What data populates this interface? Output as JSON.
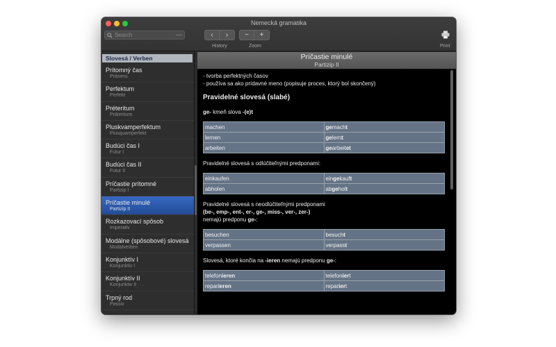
{
  "window": {
    "title": "Nemecká gramatika"
  },
  "toolbar": {
    "search_placeholder": "Search",
    "back_glyph": "‹",
    "forward_glyph": "›",
    "zoom_out_glyph": "−",
    "zoom_in_glyph": "+",
    "history_label": "History",
    "zoom_label": "Zoom",
    "print_label": "Print"
  },
  "sidebar": {
    "header": "Slovesá / Verben",
    "items": [
      {
        "title": "Prítomný čas",
        "subtitle": "Präsens",
        "selected": false
      },
      {
        "title": "Perfektum",
        "subtitle": "Perfekt",
        "selected": false
      },
      {
        "title": "Préteritum",
        "subtitle": "Präteritum",
        "selected": false
      },
      {
        "title": "Pluskvamperfektum",
        "subtitle": "Plusquamperfekt",
        "selected": false
      },
      {
        "title": "Budúci čas I",
        "subtitle": "Futur I",
        "selected": false
      },
      {
        "title": "Budúci čas II",
        "subtitle": "Futur II",
        "selected": false
      },
      {
        "title": "Príčastie prítomné",
        "subtitle": "Partizip I",
        "selected": false
      },
      {
        "title": "Príčastie minulé",
        "subtitle": "Partizip II",
        "selected": true
      },
      {
        "title": "Rozkazovací spôsob",
        "subtitle": "Imperativ",
        "selected": false
      },
      {
        "title": "Modálne (spôsobové) slovesá",
        "subtitle": "Modalverben",
        "selected": false
      },
      {
        "title": "Konjunktív I",
        "subtitle": "Konjunktiv I",
        "selected": false
      },
      {
        "title": "Konjunktív II",
        "subtitle": "Konjunktiv II",
        "selected": false
      },
      {
        "title": "Trpný rod",
        "subtitle": "Passiv",
        "selected": false
      }
    ]
  },
  "content": {
    "title": "Príčastie minulé",
    "subtitle": "Partizip II",
    "intro": [
      "- tvorba perfektných časov",
      "- používa sa ako prídavné meno (popisuje proces, ktorý bol skončený)"
    ],
    "section_title": "Pravidelné slovesá (slabé)",
    "rule_bold": "ge-",
    "rule_text": " kmeň slova ",
    "rule_suffix": "-(e)t",
    "table1": [
      {
        "inf": "machen",
        "p_pre": "",
        "p_bold": "ge",
        "p_mid": "mach",
        "p_end": "t"
      },
      {
        "inf": "lernen",
        "p_pre": "",
        "p_bold": "ge",
        "p_mid": "lern",
        "p_end": "t"
      },
      {
        "inf": "arbeiten",
        "p_pre": "",
        "p_bold": "ge",
        "p_mid": "arbeit",
        "p_end": "et"
      }
    ],
    "note2": "Pravidelné slovesá s odlúčiteľnými predponami:",
    "table2": [
      {
        "inf": "einkaufen",
        "p_pre": "ein",
        "p_bold": "ge",
        "p_mid": "kauf",
        "p_end": "t"
      },
      {
        "inf": "abholen",
        "p_pre": "ab",
        "p_bold": "ge",
        "p_mid": "hol",
        "p_end": "t"
      }
    ],
    "note3_line1": "Pravidelné slovesá s neodlúčiteľnými predponami",
    "note3_line2": "(be-, emp-, ent-, er-, ge-, miss-, ver-, zer-)",
    "note3_line3_pre": "nemajú predponu ",
    "note3_line3_bold": "ge-",
    "note3_line3_post": ":",
    "table3": [
      {
        "inf": "besuchen",
        "p_pre": "besuch",
        "p_bold": "",
        "p_mid": "",
        "p_end": "t"
      },
      {
        "inf": "verpassen",
        "p_pre": "verpass",
        "p_bold": "",
        "p_mid": "",
        "p_end": "t"
      }
    ],
    "note4_pre": "Slovesá, ktoré končia na ",
    "note4_bold1": "-ieren",
    "note4_mid": " nemajú predponu ",
    "note4_bold2": "ge-",
    "note4_post": ":",
    "table4": [
      {
        "inf_pre": "telefon",
        "inf_bold": "ieren",
        "p_pre": "telefon",
        "p_bold": "ier",
        "p_end": "t"
      },
      {
        "inf_pre": "repar",
        "inf_bold": "ieren",
        "p_pre": "repar",
        "p_bold": "ier",
        "p_end": "t"
      }
    ]
  }
}
